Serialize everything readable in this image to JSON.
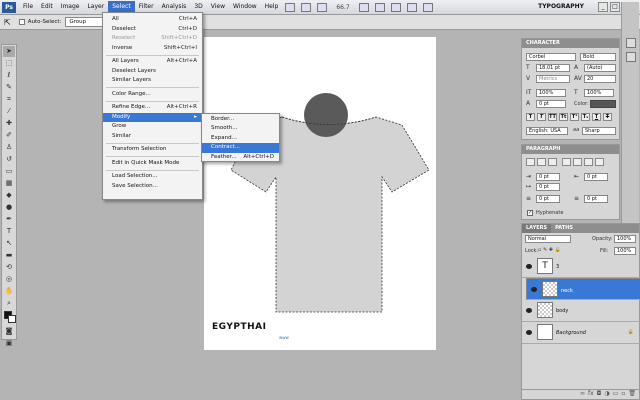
{
  "menubar": {
    "logo": "Ps",
    "items": [
      "File",
      "Edit",
      "Image",
      "Layer",
      "Select",
      "Filter",
      "Analysis",
      "3D",
      "View",
      "Window",
      "Help"
    ],
    "zoom": "66.7",
    "workspace": "TYPOGRAPHY"
  },
  "options": {
    "auto_select_label": "Auto-Select:",
    "auto_select_value": "Group"
  },
  "select_menu": {
    "groups": [
      [
        {
          "label": "All",
          "shortcut": "Ctrl+A",
          "disabled": false
        },
        {
          "label": "Deselect",
          "shortcut": "Ctrl+D",
          "disabled": false
        },
        {
          "label": "Reselect",
          "shortcut": "Shift+Ctrl+D",
          "disabled": true
        },
        {
          "label": "Inverse",
          "shortcut": "Shift+Ctrl+I",
          "disabled": false
        }
      ],
      [
        {
          "label": "All Layers",
          "shortcut": "Alt+Ctrl+A",
          "disabled": false
        },
        {
          "label": "Deselect Layers",
          "shortcut": "",
          "disabled": false
        },
        {
          "label": "Similar Layers",
          "shortcut": "",
          "disabled": false
        }
      ],
      [
        {
          "label": "Color Range...",
          "shortcut": "",
          "disabled": false
        }
      ],
      [
        {
          "label": "Refine Edge...",
          "shortcut": "Alt+Ctrl+R",
          "disabled": false
        },
        {
          "label": "Modify",
          "shortcut": "▸",
          "disabled": false,
          "highlighted": true
        },
        {
          "label": "Grow",
          "shortcut": "",
          "disabled": false
        },
        {
          "label": "Similar",
          "shortcut": "",
          "disabled": false
        }
      ],
      [
        {
          "label": "Transform Selection",
          "shortcut": "",
          "disabled": false
        }
      ],
      [
        {
          "label": "Edit in Quick Mask Mode",
          "shortcut": "",
          "disabled": false
        }
      ],
      [
        {
          "label": "Load Selection...",
          "shortcut": "",
          "disabled": false
        },
        {
          "label": "Save Selection...",
          "shortcut": "",
          "disabled": false
        }
      ]
    ]
  },
  "modify_submenu": [
    {
      "label": "Border...",
      "shortcut": ""
    },
    {
      "label": "Smooth...",
      "shortcut": ""
    },
    {
      "label": "Expand...",
      "shortcut": ""
    },
    {
      "label": "Contract...",
      "shortcut": "",
      "highlighted": true
    },
    {
      "label": "Feather...",
      "shortcut": "Alt+Ctrl+D"
    }
  ],
  "canvas": {
    "logo_text": "EGYPTHAI",
    "logo_sub": "www",
    "shirt_color": "#d3d3d3",
    "neck_color": "#5a5a5a"
  },
  "character": {
    "tab": "CHARACTER",
    "font": "Corbel",
    "style": "Bold",
    "size": "18.01 pt",
    "leading": "(Auto)",
    "kerning": "Metrics",
    "tracking": "20",
    "vscale": "100%",
    "hscale": "100%",
    "baseline": "0 pt",
    "color_label": "Color:",
    "language": "English: USA",
    "aa": "Sharp",
    "aa_label": "aa"
  },
  "paragraph": {
    "tab": "PARAGRAPH",
    "indent_left": "0 pt",
    "indent_right": "0 pt",
    "first_line": "0 pt",
    "space_before": "0 pt",
    "space_after": "0 pt",
    "hyphenate": "Hyphenate"
  },
  "layers": {
    "tabs": [
      "LAYERS",
      "PATHS"
    ],
    "blend": "Normal",
    "opacity_label": "Opacity:",
    "opacity": "100%",
    "lock_label": "Lock:",
    "fill_label": "Fill:",
    "fill": "100%",
    "items": [
      {
        "name": "3",
        "type": "text",
        "selected": false
      },
      {
        "name": "neck",
        "type": "pixel",
        "selected": true
      },
      {
        "name": "body",
        "type": "pixel",
        "selected": false
      },
      {
        "name": "Background",
        "type": "bg",
        "selected": false
      }
    ]
  }
}
